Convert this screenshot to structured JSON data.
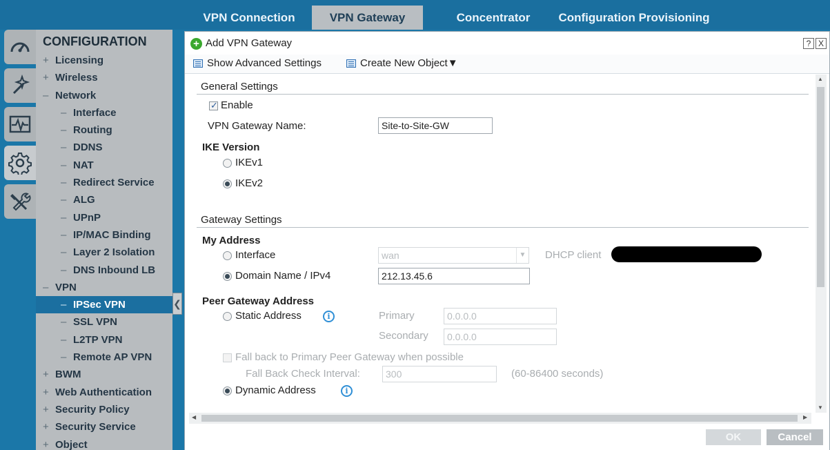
{
  "top_tabs": [
    {
      "label": "VPN Connection",
      "active": false
    },
    {
      "label": "VPN Gateway",
      "active": true
    },
    {
      "label": "Concentrator",
      "active": false
    },
    {
      "label": "Configuration Provisioning",
      "active": false
    }
  ],
  "rail": [
    "dashboard-icon",
    "wizard-icon",
    "monitor-icon",
    "gear-icon",
    "tools-icon"
  ],
  "nav": {
    "title": "CONFIGURATION",
    "items": [
      {
        "prefix": "+",
        "label": "Licensing"
      },
      {
        "prefix": "+",
        "label": "Wireless"
      },
      {
        "prefix": "–",
        "label": "Network"
      },
      {
        "prefix": "–",
        "label": "Interface"
      },
      {
        "prefix": "–",
        "label": "Routing"
      },
      {
        "prefix": "–",
        "label": "DDNS"
      },
      {
        "prefix": "–",
        "label": "NAT"
      },
      {
        "prefix": "–",
        "label": "Redirect Service"
      },
      {
        "prefix": "–",
        "label": "ALG"
      },
      {
        "prefix": "–",
        "label": "UPnP"
      },
      {
        "prefix": "–",
        "label": "IP/MAC Binding"
      },
      {
        "prefix": "–",
        "label": "Layer 2 Isolation"
      },
      {
        "prefix": "–",
        "label": "DNS Inbound LB"
      },
      {
        "prefix": "–",
        "label": "VPN"
      },
      {
        "prefix": "–",
        "label": "IPSec VPN"
      },
      {
        "prefix": "–",
        "label": "SSL VPN"
      },
      {
        "prefix": "–",
        "label": "L2TP VPN"
      },
      {
        "prefix": "–",
        "label": "Remote AP VPN"
      },
      {
        "prefix": "+",
        "label": "BWM"
      },
      {
        "prefix": "+",
        "label": "Web Authentication"
      },
      {
        "prefix": "+",
        "label": "Security Policy"
      },
      {
        "prefix": "+",
        "label": "Security Service"
      },
      {
        "prefix": "+",
        "label": "Object"
      }
    ]
  },
  "dialog": {
    "title": "Add VPN Gateway",
    "help_btn": "?",
    "close_btn": "X",
    "toolbar": {
      "advanced": "Show Advanced Settings",
      "create": "Create New Object▼"
    },
    "general": {
      "heading": "General Settings",
      "enable_label": "Enable",
      "enable_checked": true,
      "name_label": "VPN Gateway Name:",
      "name_value": "Site-to-Site-GW",
      "ike_heading": "IKE Version",
      "ikev1": "IKEv1",
      "ikev2": "IKEv2",
      "ike_selected": "IKEv2"
    },
    "gateway": {
      "heading": "Gateway Settings",
      "my_address": "My Address",
      "interface_label": "Interface",
      "interface_value": "wan",
      "dhcp_label": "DHCP client",
      "domain_label": "Domain Name / IPv4",
      "domain_value": "212.13.45.6",
      "peer_heading": "Peer Gateway Address",
      "static_label": "Static Address",
      "primary_label": "Primary",
      "primary_value": "0.0.0.0",
      "secondary_label": "Secondary",
      "secondary_value": "0.0.0.0",
      "fallback_label": "Fall back to Primary Peer Gateway when possible",
      "fallback_interval_label": "Fall Back Check Interval:",
      "fallback_interval_value": "300",
      "fallback_range": "(60-86400 seconds)",
      "dynamic_label": "Dynamic Address"
    },
    "footer": {
      "ok": "OK",
      "cancel": "Cancel"
    }
  }
}
